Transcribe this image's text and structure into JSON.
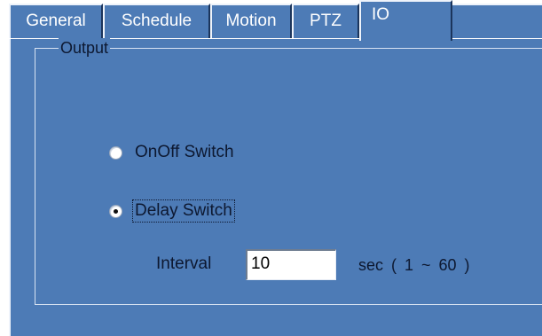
{
  "tabs": [
    {
      "label": "General",
      "active": false
    },
    {
      "label": "Schedule",
      "active": false
    },
    {
      "label": "Motion",
      "active": false
    },
    {
      "label": "PTZ",
      "active": false
    },
    {
      "label": "IO",
      "active": true
    }
  ],
  "output_group": {
    "title": "Output",
    "options": [
      {
        "label": "OnOff Switch",
        "selected": false
      },
      {
        "label": "Delay Switch",
        "selected": true
      }
    ],
    "interval": {
      "label": "Interval",
      "value": "10",
      "unit": "sec  ( 1 ~ 60 )"
    }
  },
  "colors": {
    "panel": "#4d7bb6",
    "highlight": "#eef3fb",
    "text": "#0d1830"
  }
}
